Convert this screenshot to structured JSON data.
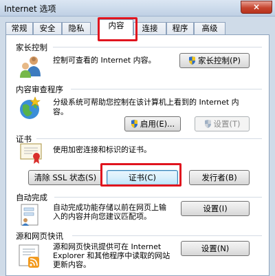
{
  "window": {
    "title": "Internet 选项",
    "close_label": "×"
  },
  "tabs": [
    {
      "label": "常规"
    },
    {
      "label": "安全"
    },
    {
      "label": "隐私"
    },
    {
      "label": "内容",
      "active": true
    },
    {
      "label": "连接"
    },
    {
      "label": "程序"
    },
    {
      "label": "高级"
    }
  ],
  "sections": {
    "parental": {
      "title": "家长控制",
      "desc": "控制可查看的 Internet 内容。",
      "button": "家长控制(P)",
      "icon": "parental-controls-icon"
    },
    "advisor": {
      "title": "内容审查程序",
      "desc_line1": "分级系统可帮助您控制在该计算机上看到的 Internet 内",
      "desc_line2": "容。",
      "enable_button": "启用(E)...",
      "settings_button": "设置(T)",
      "icon": "content-advisor-globe-icon"
    },
    "certificates": {
      "title": "证书",
      "desc": "使用加密连接和标识的证书。",
      "clear_ssl_button": "清除 SSL 状态(S)",
      "certs_button": "证书(C)",
      "publishers_button": "发行者(B)",
      "icon": "certificate-icon"
    },
    "autocomplete": {
      "title": "自动完成",
      "desc_line1": "自动完成功能存储以前在网页上输",
      "desc_line2": "入的内容并向您建议匹配项。",
      "button": "设置(I)",
      "icon": "autocomplete-form-icon"
    },
    "feeds": {
      "title": "源和网页快讯",
      "desc_line1": "源和网页快讯提供可在 Internet",
      "desc_line2": "Explorer 和其他程序中读取的网站",
      "desc_line3": "更新内容。",
      "button": "设置(N)",
      "icon": "feeds-icon"
    }
  },
  "colors": {
    "highlight": "#e0141e",
    "panel_bg": "#ffffff",
    "window_bg": "#cfdbe8"
  }
}
